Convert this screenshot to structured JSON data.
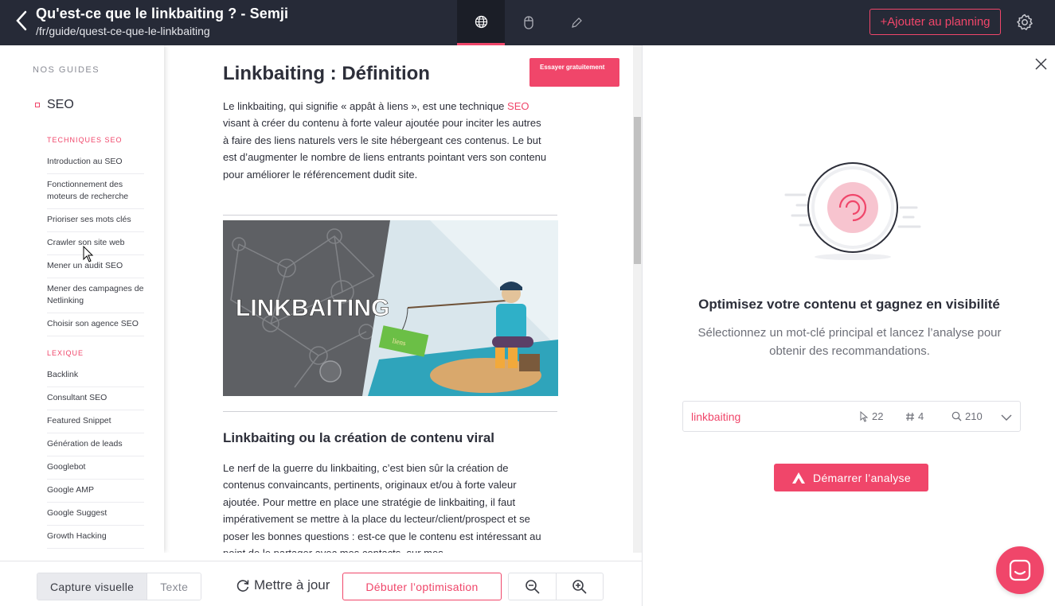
{
  "header": {
    "title": "Qu'est-ce que le linkbaiting ? - Semji",
    "url": "/fr/guide/quest-ce-que-le-linkbaiting",
    "add_to_planning": "+Ajouter au planning"
  },
  "sidebar": {
    "title": "NOS GUIDES",
    "root": "SEO",
    "section1": "TECHNIQUES SEO",
    "section1_items": [
      "Introduction au SEO",
      "Fonctionnement des moteurs de recherche",
      "Prioriser ses mots clés",
      "Crawler son site web",
      "Mener un audit SEO",
      "Mener des campagnes de Netlinking",
      "Choisir son agence SEO"
    ],
    "section2": "LEXIQUE",
    "section2_items": [
      "Backlink",
      "Consultant SEO",
      "Featured Snippet",
      "Génération de leads",
      "Googlebot",
      "Google AMP",
      "Google Suggest",
      "Growth Hacking"
    ]
  },
  "article": {
    "h1": "Linkbaiting : Définition",
    "try_button": "Essayer gratuitement",
    "p1_before": "Le linkbaiting, qui signifie « appât à liens », est une technique ",
    "p1_link": "SEO",
    "p1_after": " visant à créer du contenu à forte valeur ajoutée pour inciter les autres à faire des liens naturels vers le site hébergeant ces contenus. Le but est d’augmenter le nombre de liens entrants pointant vers son contenu pour améliorer le référencement dudit site.",
    "banner_text": "LINKBAITING",
    "banner_sign": "liens",
    "h2": "Linkbaiting ou la création de contenu viral",
    "p2": "Le nerf de la guerre du linkbaiting, c’est bien sûr la création de contenus convaincants, pertinents, originaux et/ou à forte valeur ajoutée. Pour mettre en place une stratégie de linkbaiting, il faut impérativement se mettre à la place du lecteur/client/prospect et se poser les bonnes questions : est-ce que le contenu est intéressant au point de le partager avec mes contacts, sur mes"
  },
  "toolbar": {
    "visual": "Capture visuelle",
    "text": "Texte",
    "refresh": "Mettre à jour",
    "optimize": "Débuter l’optimisation"
  },
  "panel": {
    "heading": "Optimisez votre contenu et gagnez en visibilité",
    "subtitle": "Sélectionnez un mot-clé principal et lancez l’analyse pour obtenir des recommandations.",
    "keyword": "linkbaiting",
    "clicks": "22",
    "position": "4",
    "volume": "210",
    "start": "Démarrer l’analyse"
  },
  "colors": {
    "accent": "#f0466a",
    "topbar": "#262a37"
  }
}
